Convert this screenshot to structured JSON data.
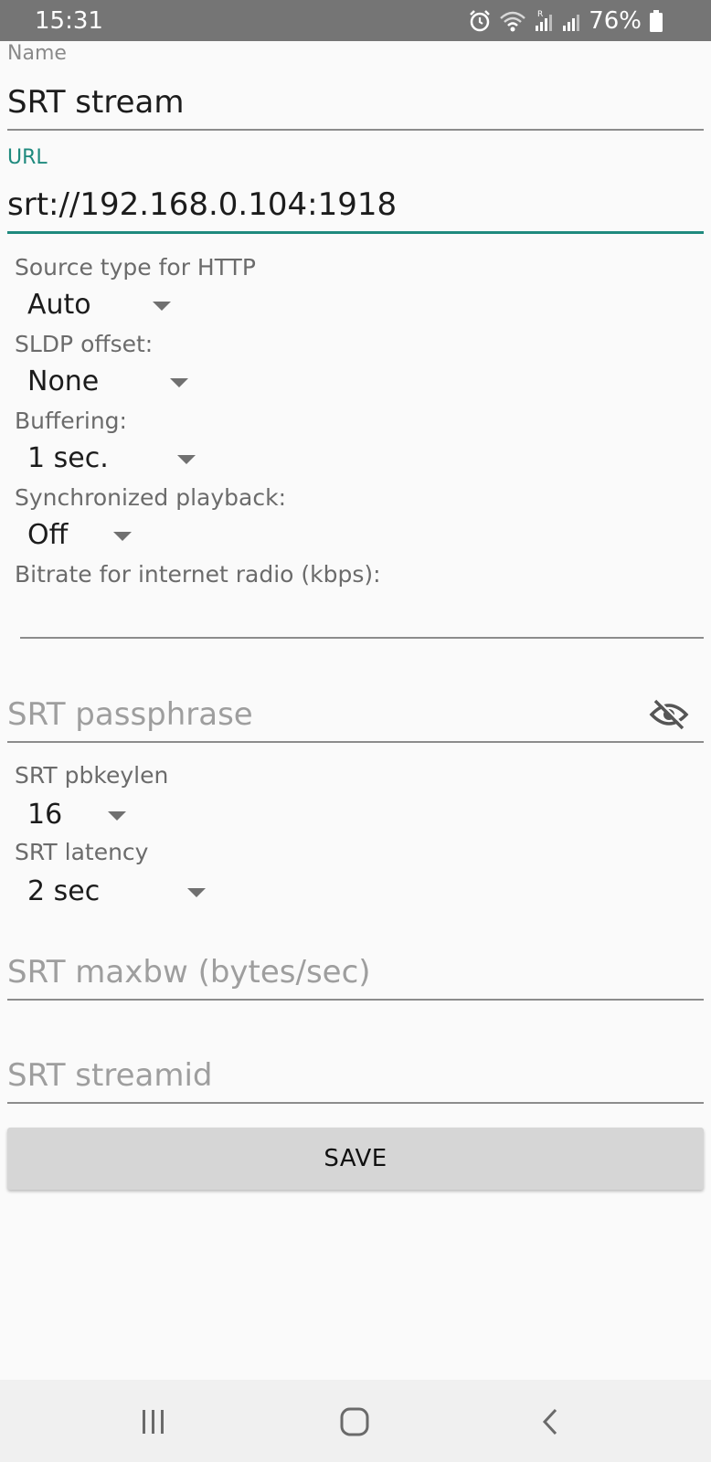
{
  "status_bar": {
    "time": "15:31",
    "battery_text": "76%",
    "icons": [
      "alarm-icon",
      "wifi-icon",
      "signal-icon",
      "signal-icon",
      "battery-icon"
    ]
  },
  "form": {
    "name": {
      "label": "Name",
      "value": "SRT stream"
    },
    "url": {
      "label": "URL",
      "value": "srt://192.168.0.104:1918"
    },
    "source_type": {
      "label": "Source type for HTTP",
      "value": "Auto"
    },
    "sldp_offset": {
      "label": "SLDP offset:",
      "value": "None"
    },
    "buffering": {
      "label": "Buffering:",
      "value": "1 sec."
    },
    "sync_playback": {
      "label": "Synchronized playback:",
      "value": "Off"
    },
    "bitrate": {
      "label": "Bitrate for internet radio (kbps):",
      "value": ""
    },
    "passphrase": {
      "placeholder": "SRT passphrase"
    },
    "pbkeylen": {
      "label": "SRT pbkeylen",
      "value": "16"
    },
    "latency": {
      "label": "SRT latency",
      "value": "2 sec"
    },
    "maxbw": {
      "placeholder": "SRT maxbw (bytes/sec)"
    },
    "streamid": {
      "placeholder": "SRT streamid"
    },
    "save_label": "SAVE"
  },
  "nav_bar": {
    "icons": [
      "recent-apps-icon",
      "home-icon",
      "back-icon"
    ]
  },
  "colors": {
    "accent": "#1f8a7e",
    "status_bar": "#757575",
    "background": "#fafafa",
    "button": "#d6d6d6"
  }
}
